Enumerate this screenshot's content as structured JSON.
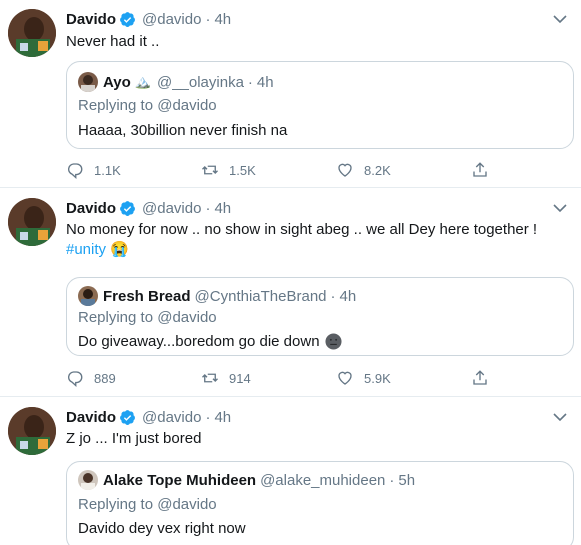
{
  "tweets": [
    {
      "name": "Davido",
      "handle": "@davido",
      "sep": "·",
      "time": "4h",
      "text": "Never had it ..",
      "hashtag": "",
      "emoji": "",
      "quote": {
        "name": "Ayo",
        "badge": "🏔️",
        "handle": "@__olayinka",
        "sep": "·",
        "time": "4h",
        "replying": "Replying to @davido",
        "text": "Haaaa, 30billion never finish na"
      },
      "stats": {
        "replies": "1.1K",
        "retweets": "1.5K",
        "likes": "8.2K"
      }
    },
    {
      "name": "Davido",
      "handle": "@davido",
      "sep": "·",
      "time": "4h",
      "text": "No money for now .. no show in sight abeg .. we all Dey here together !",
      "hashtag": "#unity",
      "emoji": "😭",
      "quote": {
        "name": "Fresh Bread",
        "badge": "",
        "handle": "@CynthiaTheBrand",
        "sep": "·",
        "time": "4h",
        "replying": "Replying to @davido",
        "text": "Do giveaway...boredom go die down"
      },
      "stats": {
        "replies": "889",
        "retweets": "914",
        "likes": "5.9K"
      }
    },
    {
      "name": "Davido",
      "handle": "@davido",
      "sep": "·",
      "time": "4h",
      "text": "Z jo ... I'm just bored",
      "hashtag": "",
      "emoji": "",
      "quote": {
        "name": "Alake Tope Muhideen",
        "badge": "",
        "handle": "@alake_muhideen",
        "sep": "·",
        "time": "5h",
        "replying": "Replying to @davido",
        "text": "Davido dey vex right now"
      },
      "stats": {
        "replies": "",
        "retweets": "",
        "likes": ""
      }
    }
  ],
  "colors": {
    "accent": "#1da1f2",
    "secondary_text": "#657786",
    "border": "#e6ecf0"
  },
  "icons": [
    "verified-icon",
    "caret-down-icon",
    "reply-icon",
    "retweet-icon",
    "like-icon",
    "share-icon"
  ]
}
